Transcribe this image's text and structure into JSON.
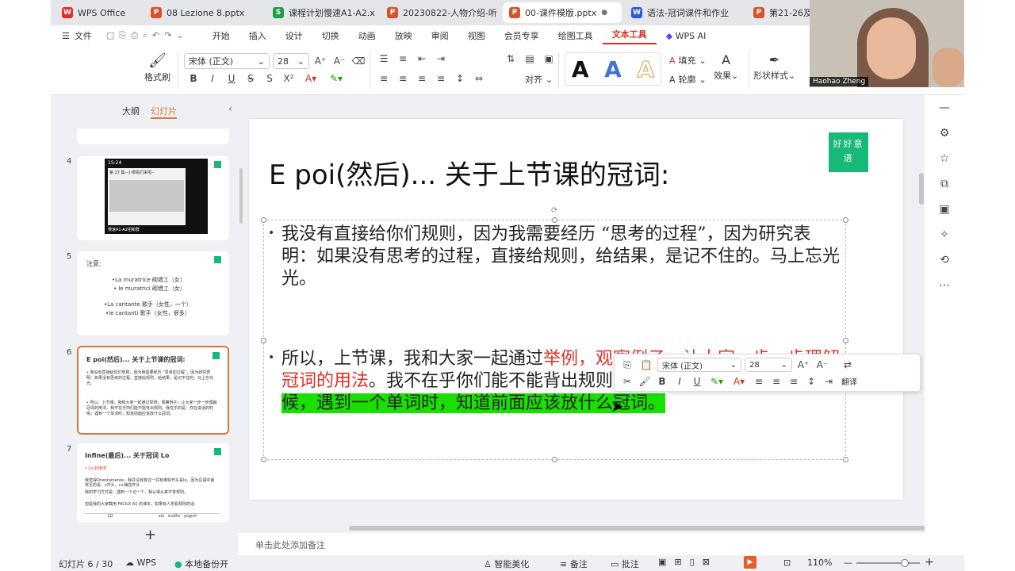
{
  "tabs": [
    {
      "label": "WPS Office",
      "icon": "W",
      "color": "#e0302a"
    },
    {
      "label": "08 Lezione 8.pptx",
      "icon": "P",
      "color": "#d9532a"
    },
    {
      "label": "课程计划慢速A1-A2.x",
      "icon": "S",
      "color": "#1d9e4a"
    },
    {
      "label": "20230822-人物介绍-听",
      "icon": "P",
      "color": "#d9532a"
    },
    {
      "label": "00-课件模版.pptx",
      "icon": "P",
      "color": "#d9532a"
    },
    {
      "label": "语法-冠词课件和作业",
      "icon": "W",
      "color": "#2d5bd7"
    },
    {
      "label": "第21-26及.ppt",
      "icon": "P",
      "color": "#d9532a"
    }
  ],
  "menu": {
    "file": "文件",
    "items": [
      "开始",
      "插入",
      "设计",
      "切换",
      "动画",
      "放映",
      "审阅",
      "视图",
      "会员专享",
      "绘图工具",
      "文本工具"
    ],
    "active": "文本工具",
    "ai": "WPS AI"
  },
  "ribbon": {
    "format_painter": "格式刷",
    "font": "宋体 (正文)",
    "size": "28",
    "align": "对齐",
    "fill": "填充",
    "outline": "轮廓",
    "effect": "效果",
    "shape_style": "形状样式"
  },
  "panel": {
    "outline_tab": "大纲",
    "slides_tab": "幻灯片",
    "add": "+"
  },
  "thumbs": {
    "n4": "4",
    "n5": "5",
    "n6": "6",
    "n7": "7",
    "t4_caption": "第 27 集--小慢看们来啦--",
    "t4_time": "15:24",
    "t4_foot": "慢速A1-A2招新群",
    "t5_title": "注意:",
    "t5_lines": [
      "•La muratrice 砌墙工（女）",
      "• le muratrici 砌墙工（女）",
      "•La cantante 歌手（女性，一个）",
      "•le cantanti 歌手（女性，很多）"
    ],
    "t6_title": "E poi(然后)... 关于上节课的冠词:",
    "t6_p1": "• 我没有直接给你们规则，因为我需要经历 “思考的过程”，因为研究表明：如果没有思考的过程，直接给规则，给结果，是记不住的。马上忘光光。",
    "t6_p2": "• 所以，上节课，我和大家一起通过举例，观察例子，让大家一步一步理解冠词的用法。我不在乎你们能不能背出规则，我在乎的是：你在说话的时候，遇到一个单词时，知道前面应该放什么冠词。",
    "t7_title": "Infine(最后)... 关于冠词 Lo",
    "t7_l1": "• Lo 的用法:",
    "t7_l2": "我觉得Onestamente，我并没有数过一共有哪些开头是lo，因为在语中最常见的是：z开头，s+辅音开头",
    "t7_l3": "我的学习方式是：遇到一个记一个，我认得从来不背规则。",
    "t7_l4": "但是我的大家截用 FACILE A1 的课本，如果有人想看规则的话:",
    "t7_c1": "LO",
    "t7_c2": "zio · scotto · yogurt"
  },
  "slide": {
    "title": "E poi(然后)... 关于上节课的冠词:",
    "badge": "好好意语",
    "p1": "我没有直接给你们规则，因为我需要经历 “思考的过程”，因为研究表明：如果没有思考的过程，直接给规则，给结果，是记不住的。马上忘光光。",
    "p2_a": "所以，上节课，我和大家一起通过",
    "p2_red": "举例，观察例子，让大家一步一步理解冠词的用法",
    "p2_b": "。我不在乎你们能不能背出规则，我在乎的是：",
    "p2_hl": "你在说话的时候，遇到一个单词时，知道前面应该放什么冠词。",
    "bullet": "•"
  },
  "minibar": {
    "font": "宋体 (正文)",
    "size": "28",
    "translate": "翻译"
  },
  "notes": "单击此处添加备注",
  "status": {
    "slide": "幻灯片 6 / 30",
    "wps": "WPS",
    "backup": "本地备份开",
    "beautify": "智能美化",
    "notes": "备注",
    "comment": "批注",
    "zoom": "110%"
  },
  "video": {
    "name": "Haohao Zheng"
  }
}
